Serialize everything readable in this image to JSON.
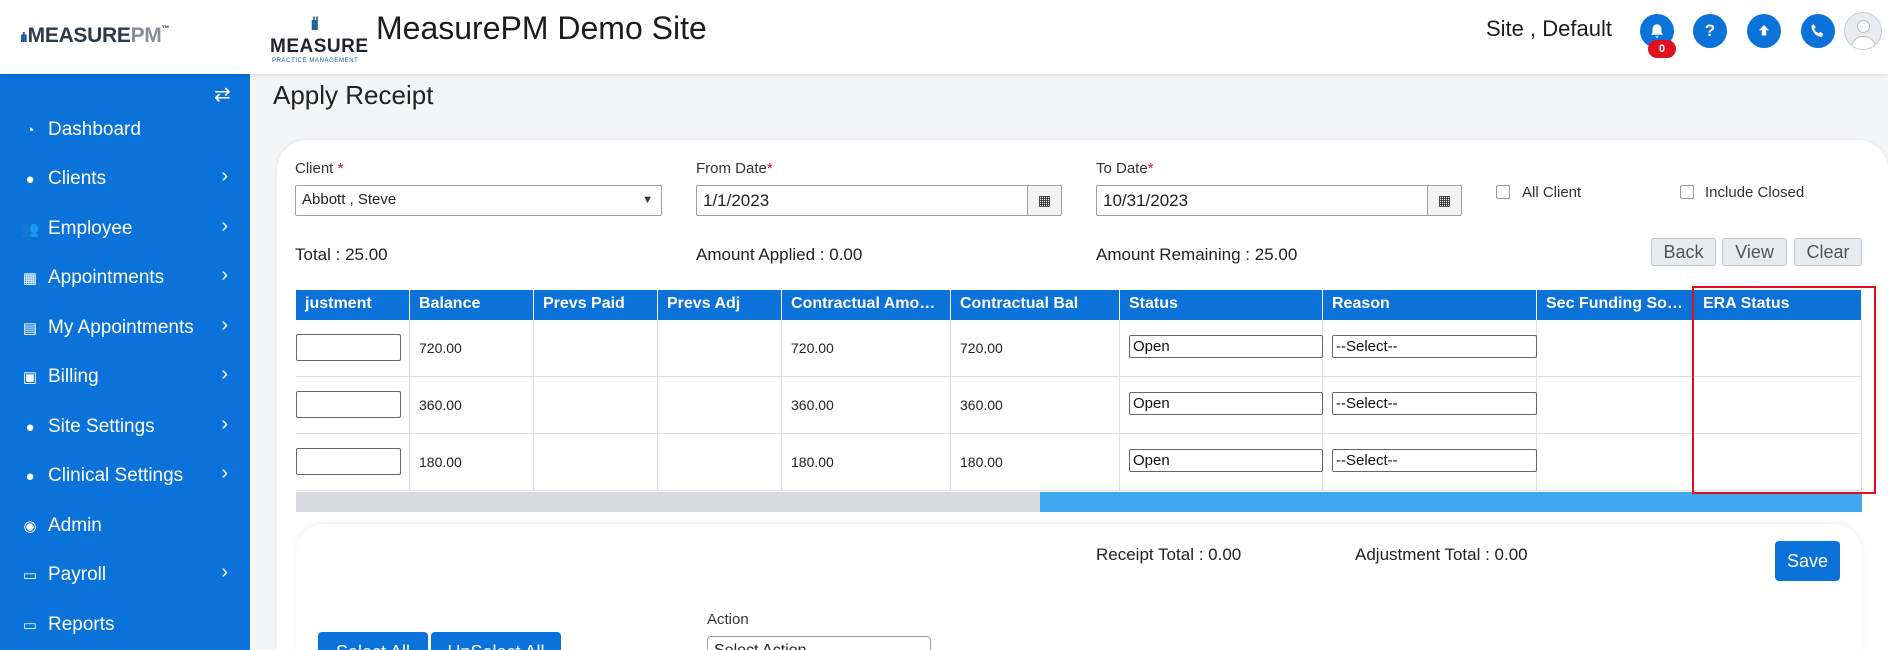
{
  "header": {
    "brand_logo": {
      "main": "MEASURE",
      "accent": "PM",
      "tm": "™"
    },
    "site_logo": {
      "word": "MEASURE",
      "sub": "PRACTICE MANAGEMENT"
    },
    "site_title": "MeasurePM Demo Site",
    "site_user": "Site , Default",
    "notification_count": "0",
    "icons": [
      "bell-icon",
      "help-icon",
      "upload-icon",
      "phone-icon",
      "user-avatar"
    ]
  },
  "sidebar": {
    "items": [
      {
        "label": "Dashboard",
        "icon": "dashboard-icon",
        "has_children": false
      },
      {
        "label": "Clients",
        "icon": "user-icon",
        "has_children": true
      },
      {
        "label": "Employee",
        "icon": "users-icon",
        "has_children": true
      },
      {
        "label": "Appointments",
        "icon": "calendar-icon",
        "has_children": true
      },
      {
        "label": "My Appointments",
        "icon": "building-icon",
        "has_children": true
      },
      {
        "label": "Billing",
        "icon": "money-icon",
        "has_children": true
      },
      {
        "label": "Site Settings",
        "icon": "user-icon",
        "has_children": true
      },
      {
        "label": "Clinical Settings",
        "icon": "user-icon",
        "has_children": true
      },
      {
        "label": "Admin",
        "icon": "user-circle-icon",
        "has_children": false
      },
      {
        "label": "Payroll",
        "icon": "card-icon",
        "has_children": true
      },
      {
        "label": "Reports",
        "icon": "card-icon",
        "has_children": false
      }
    ]
  },
  "page": {
    "title": "Apply Receipt",
    "filters": {
      "client_label": "Client",
      "client_required": "*",
      "client_value": "Abbott , Steve",
      "from_date_label": "From Date",
      "from_date_value": "1/1/2023",
      "to_date_label": "To Date",
      "to_date_value": "10/31/2023",
      "all_client_label": "All Client",
      "include_closed_label": "Include Closed"
    },
    "totals": {
      "total": "Total : 25.00",
      "amount_applied": "Amount Applied : 0.00",
      "amount_remaining": "Amount Remaining : 25.00"
    },
    "buttons": {
      "back": "Back",
      "view": "View",
      "clear": "Clear",
      "save": "Save",
      "select_all": "Select All",
      "unselect_all": "UnSelect All"
    },
    "grid": {
      "columns": [
        "justment",
        "Balance",
        "Prevs Paid",
        "Prevs Adj",
        "Contractual Amou...",
        "Contractual Bal",
        "Status",
        "Reason",
        "Sec Funding Sou...",
        "ERA Status"
      ],
      "rows": [
        {
          "adjustment": "",
          "balance": "720.00",
          "prevs_paid": "",
          "prevs_adj": "",
          "contractual_amount": "720.00",
          "contractual_bal": "720.00",
          "status": "Open",
          "reason": "--Select--",
          "sec_funding": "",
          "era_status": ""
        },
        {
          "adjustment": "",
          "balance": "360.00",
          "prevs_paid": "",
          "prevs_adj": "",
          "contractual_amount": "360.00",
          "contractual_bal": "360.00",
          "status": "Open",
          "reason": "--Select--",
          "sec_funding": "",
          "era_status": ""
        },
        {
          "adjustment": "",
          "balance": "180.00",
          "prevs_paid": "",
          "prevs_adj": "",
          "contractual_amount": "180.00",
          "contractual_bal": "180.00",
          "status": "Open",
          "reason": "--Select--",
          "sec_funding": "",
          "era_status": ""
        }
      ]
    },
    "summary": {
      "receipt_total": "Receipt Total : 0.00",
      "adjustment_total": "Adjustment Total : 0.00",
      "action_label": "Action",
      "action_value": "Select Action"
    }
  }
}
